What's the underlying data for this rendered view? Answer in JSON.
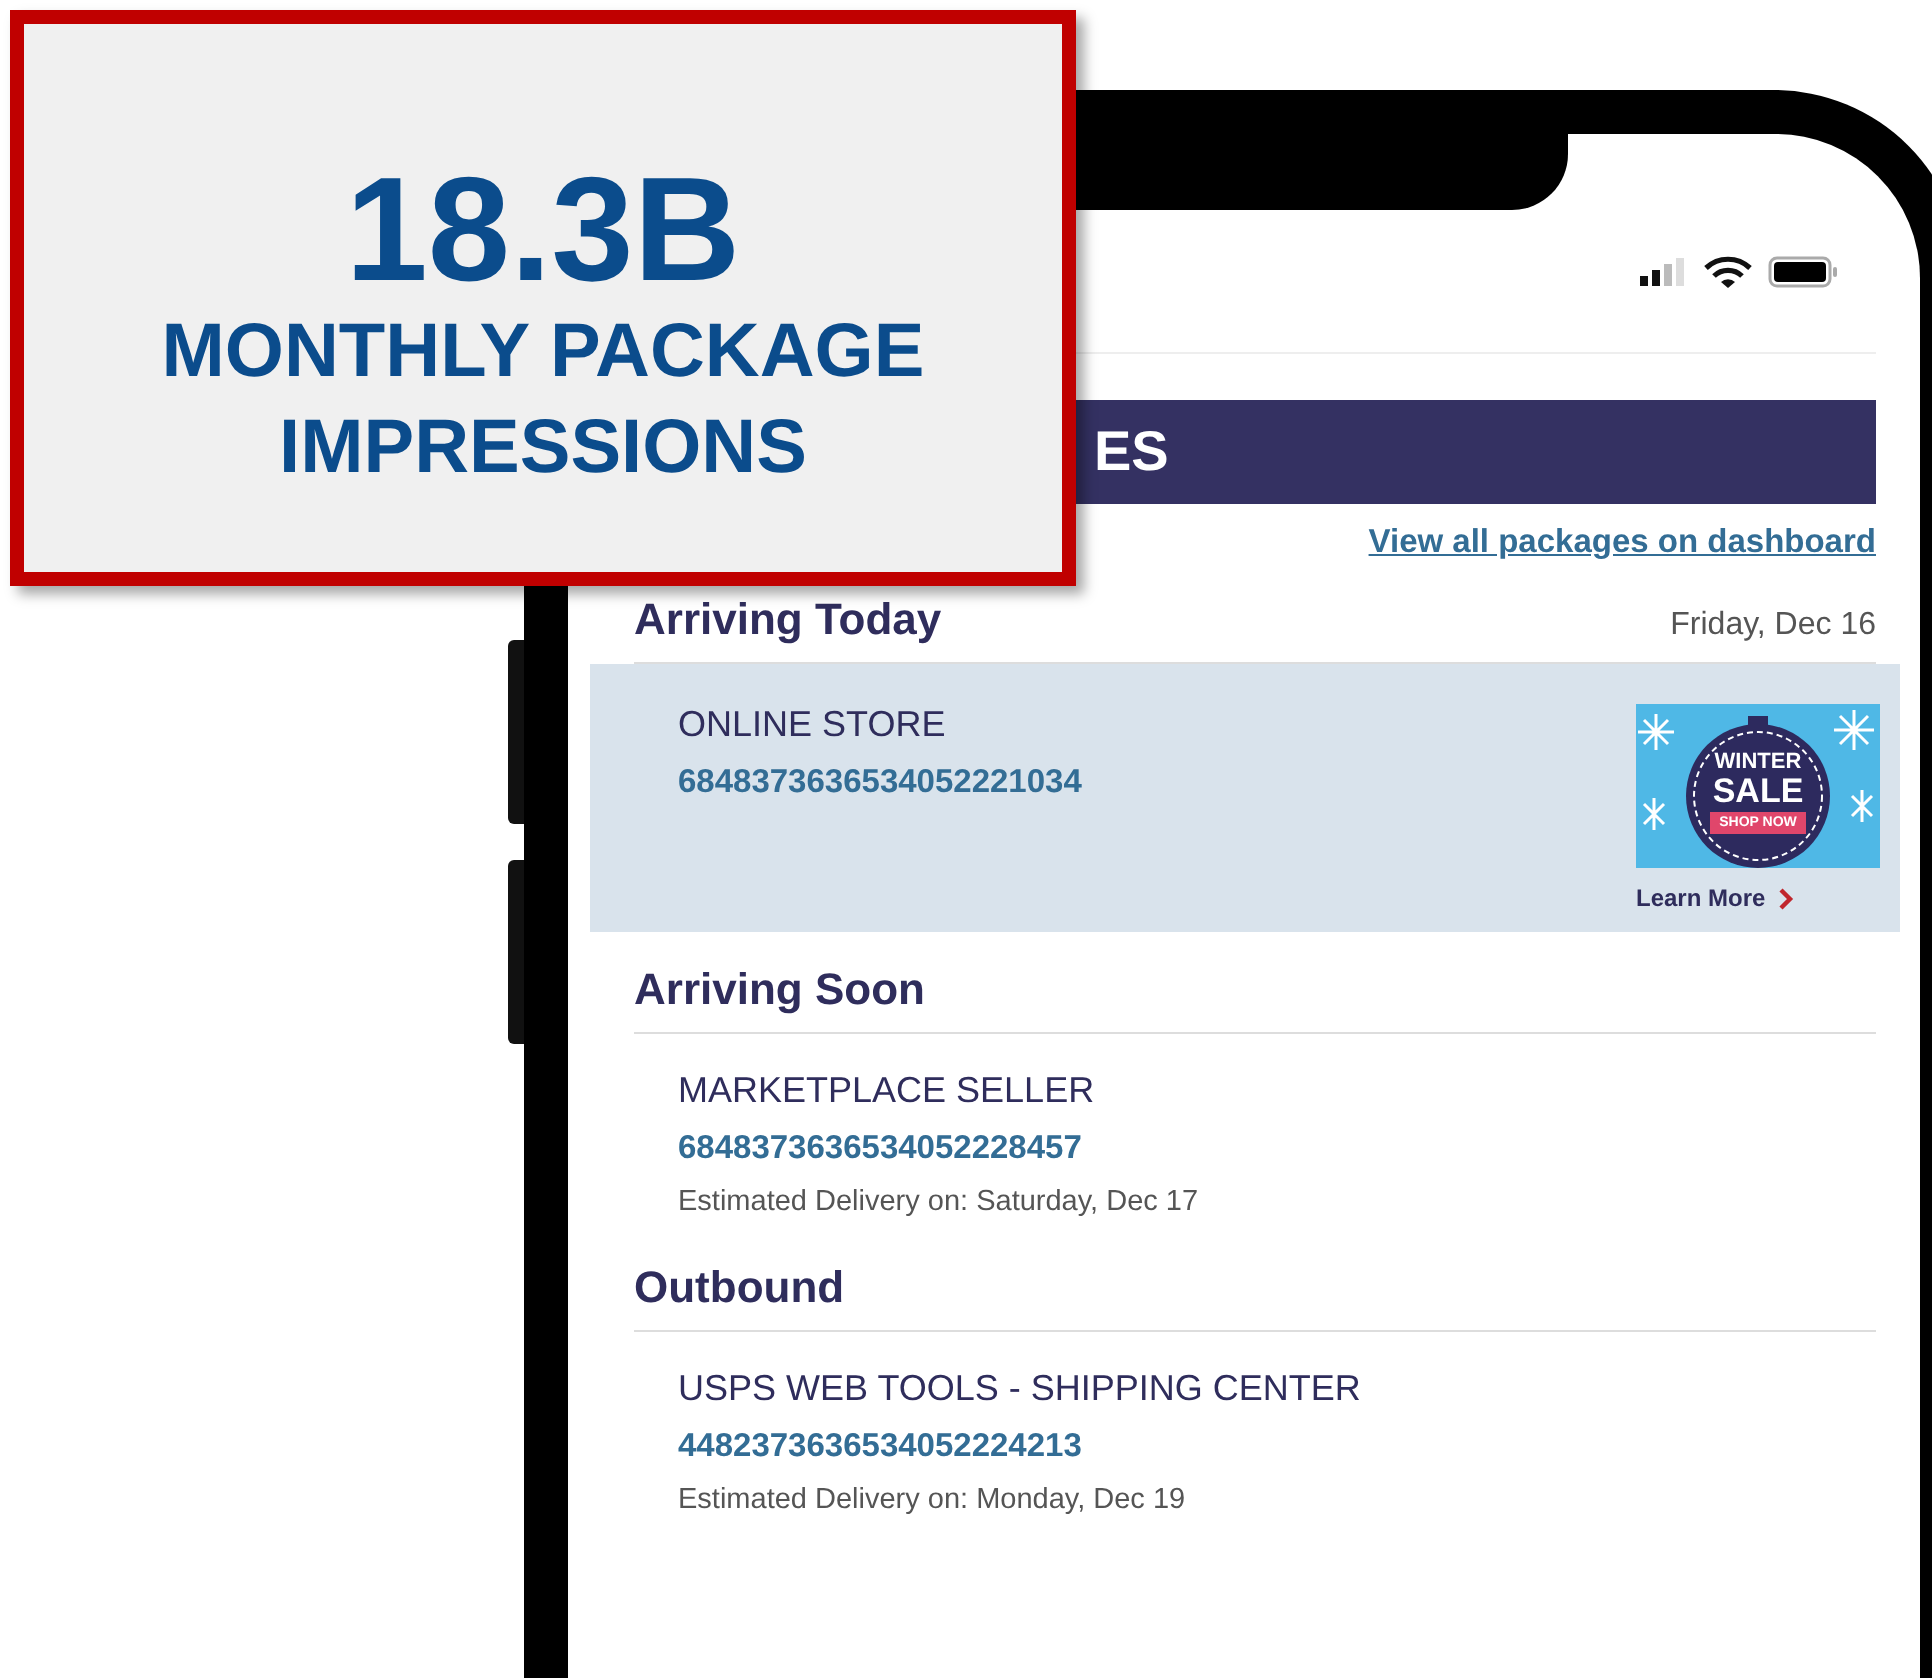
{
  "callout": {
    "figure": "18.3B",
    "caption_lines": [
      "MONTHLY PACKAGE",
      "IMPRESSIONS"
    ]
  },
  "banner": {
    "title": "ES"
  },
  "dashboard_link": "View all packages on dashboard",
  "sections": [
    {
      "title": "Arriving Today",
      "date": "Friday, Dec 16",
      "packages": [
        {
          "sender": "ONLINE STORE",
          "tracking": "6848373636534052221034",
          "highlighted": true,
          "ad": {
            "line1": "WINTER",
            "line2": "SALE",
            "button": "SHOP NOW",
            "link": "Learn More"
          }
        }
      ]
    },
    {
      "title": "Arriving Soon",
      "packages": [
        {
          "sender": "MARKETPLACE SELLER",
          "tracking": "6848373636534052228457",
          "estimate": "Estimated Delivery on: Saturday, Dec 17",
          "highlighted": false
        }
      ]
    },
    {
      "title": "Outbound",
      "packages": [
        {
          "sender": "USPS WEB TOOLS - SHIPPING CENTER",
          "tracking": "4482373636534052224213",
          "estimate": "Estimated Delivery on: Monday, Dec 19",
          "highlighted": false
        }
      ]
    }
  ]
}
